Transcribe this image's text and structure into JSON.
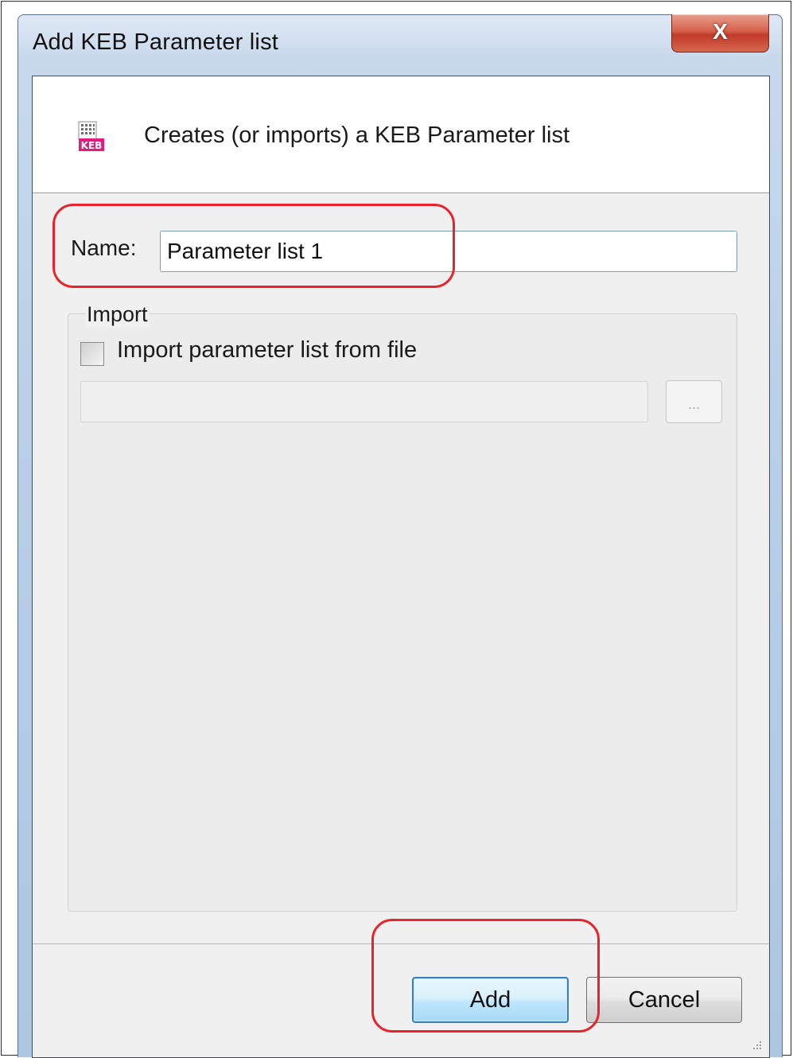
{
  "window": {
    "title": "Add KEB Parameter list",
    "close_glyph": "X"
  },
  "header": {
    "icon": "keb-parameter-list-icon",
    "icon_text": "KEB",
    "description": "Creates (or imports) a KEB Parameter list"
  },
  "form": {
    "name_label": "Name:",
    "name_value": "Parameter list 1",
    "import_group_label": "Import",
    "import_checkbox_label": "Import parameter list from file",
    "import_checked": false,
    "file_path_value": "",
    "browse_label": "..."
  },
  "buttons": {
    "add_label": "Add",
    "cancel_label": "Cancel"
  },
  "colors": {
    "annotation": "#e8232b",
    "icon_accent": "#e6197e",
    "default_button_border": "#3c7fb1"
  }
}
